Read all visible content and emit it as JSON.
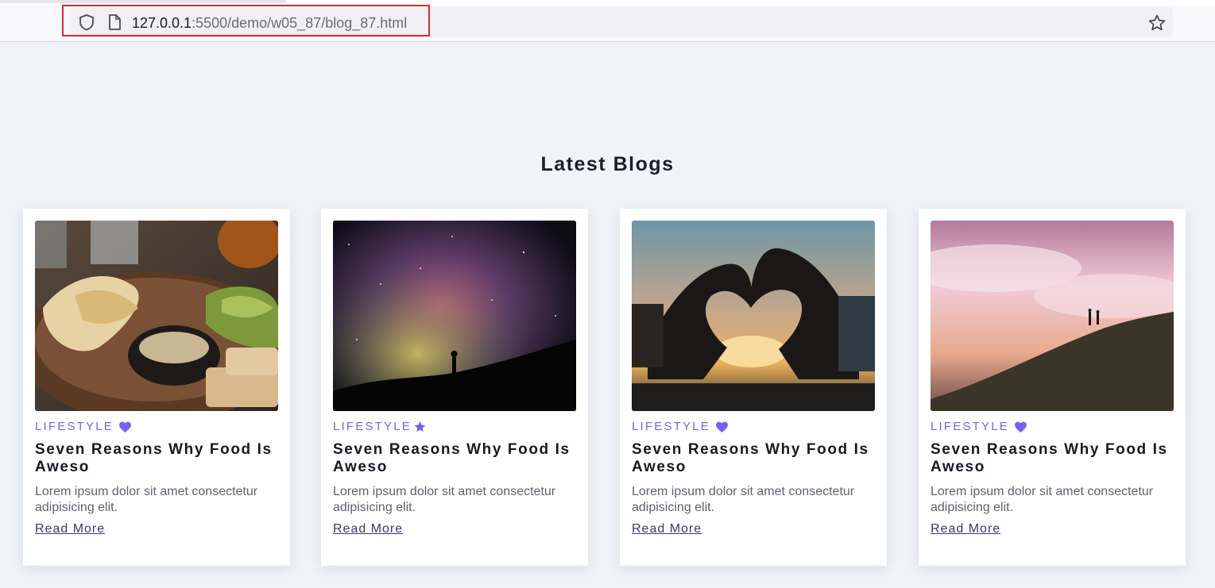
{
  "browser": {
    "url_host": "127.0.0.1",
    "url_path": ":5500/demo/w05_87/blog_87.html",
    "icons": [
      "shield-icon",
      "page-icon",
      "star-icon"
    ]
  },
  "page": {
    "title": "Latest Blogs",
    "accent_color": "#7661ee"
  },
  "cards": [
    {
      "image": "food-photo",
      "category": "LIFESTYLE",
      "category_icon": "heart-icon",
      "title": "Seven Reasons Why Food Is Aweso",
      "description": "Lorem ipsum dolor sit amet consectetur adipisicing elit.",
      "link": "Read More"
    },
    {
      "image": "galaxy-photo",
      "category": "LIFESTYLE",
      "category_icon": "star-icon",
      "title": "Seven Reasons Why Food Is Aweso",
      "description": "Lorem ipsum dolor sit amet consectetur adipisicing elit.",
      "link": "Read More"
    },
    {
      "image": "heart-hands-photo",
      "category": "LIFESTYLE",
      "category_icon": "heart-icon",
      "title": "Seven Reasons Why Food Is Aweso",
      "description": "Lorem ipsum dolor sit amet consectetur adipisicing elit.",
      "link": "Read More"
    },
    {
      "image": "hill-sunset-photo",
      "category": "LIFESTYLE",
      "category_icon": "heart-icon",
      "title": "Seven Reasons Why Food Is Aweso",
      "description": "Lorem ipsum dolor sit amet consectetur adipisicing elit.",
      "link": "Read More"
    }
  ]
}
